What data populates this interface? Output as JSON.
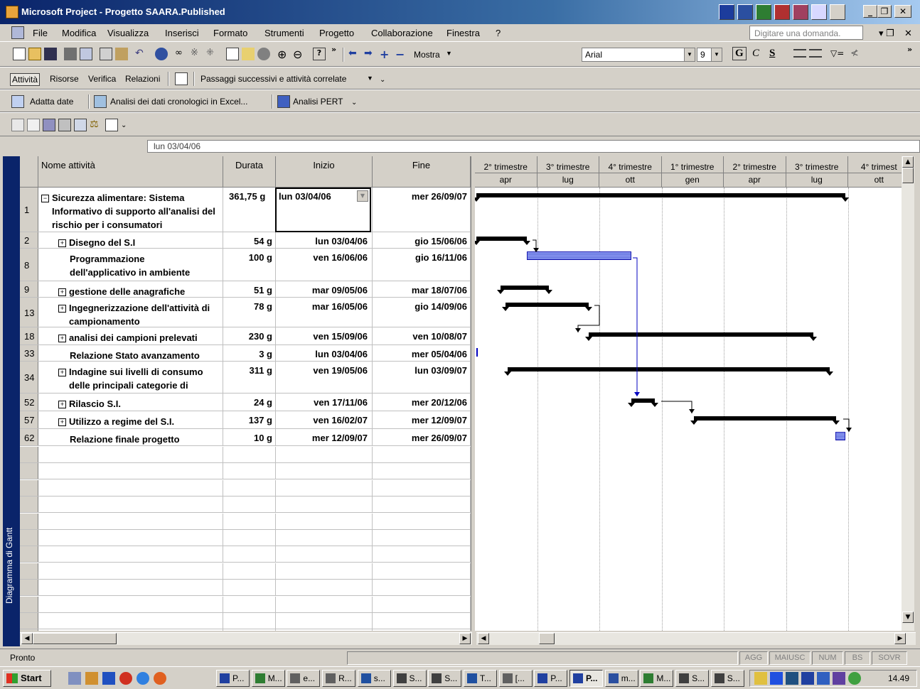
{
  "window": {
    "title": "Microsoft Project - Progetto SAARA.Published"
  },
  "menu": {
    "items": [
      "File",
      "Modifica",
      "Visualizza",
      "Inserisci",
      "Formato",
      "Strumenti",
      "Progetto",
      "Collaborazione",
      "Finestra",
      "?"
    ],
    "ask_placeholder": "Digitare una domanda."
  },
  "toolbar_standard": {
    "show_label": "Mostra",
    "font": "Arial",
    "font_size": "9",
    "bold": "G",
    "italic": "C",
    "underline": "S"
  },
  "toolbar_guide": {
    "items": [
      "Attività",
      "Risorse",
      "Verifica",
      "Relazioni"
    ],
    "guide_label": "Passaggi successivi e attività correlate"
  },
  "toolbar_analysis": {
    "adjust_dates": "Adatta date",
    "excel_analysis": "Analisi dei dati cronologici in Excel...",
    "pert": "Analisi PERT"
  },
  "entry_bar": {
    "value": "lun 03/04/06"
  },
  "view_bar": {
    "label": "Diagramma di Gantt"
  },
  "table": {
    "headers": {
      "name": "Nome attività",
      "duration": "Durata",
      "start": "Inizio",
      "finish": "Fine"
    },
    "rows": [
      {
        "id": "1",
        "expander": "−",
        "name": "Sicurezza alimentare: Sistema Informativo di supporto all'analisi del rischio per i consumatori",
        "duration": "361,75 g",
        "start": "lun 03/04/06",
        "finish": "mer 26/09/07"
      },
      {
        "id": "2",
        "expander": "+",
        "name": "Disegno del S.I",
        "duration": "54 g",
        "start": "lun 03/04/06",
        "finish": "gio 15/06/06"
      },
      {
        "id": "8",
        "expander": "",
        "name": "Programmazione dell'applicativo in ambiente",
        "duration": "100 g",
        "start": "ven 16/06/06",
        "finish": "gio 16/11/06"
      },
      {
        "id": "9",
        "expander": "+",
        "name": "gestione delle anagrafiche",
        "duration": "51 g",
        "start": "mar 09/05/06",
        "finish": "mar 18/07/06"
      },
      {
        "id": "13",
        "expander": "+",
        "name": "Ingegnerizzazione dell'attività di campionamento",
        "duration": "78 g",
        "start": "mar 16/05/06",
        "finish": "gio 14/09/06"
      },
      {
        "id": "18",
        "expander": "+",
        "name": "analisi dei campioni prelevati",
        "duration": "230 g",
        "start": "ven 15/09/06",
        "finish": "ven 10/08/07"
      },
      {
        "id": "33",
        "expander": "",
        "name": "Relazione Stato avanzamento",
        "duration": "3 g",
        "start": "lun 03/04/06",
        "finish": "mer 05/04/06"
      },
      {
        "id": "34",
        "expander": "+",
        "name": "Indagine sui livelli di consumo delle principali categorie di",
        "duration": "311 g",
        "start": "ven 19/05/06",
        "finish": "lun 03/09/07"
      },
      {
        "id": "52",
        "expander": "+",
        "name": "Rilascio S.I.",
        "duration": "24 g",
        "start": "ven 17/11/06",
        "finish": "mer 20/12/06"
      },
      {
        "id": "57",
        "expander": "+",
        "name": "Utilizzo a regime del S.I.",
        "duration": "137 g",
        "start": "ven 16/02/07",
        "finish": "mer 12/09/07"
      },
      {
        "id": "62",
        "expander": "",
        "name": "Relazione finale progetto",
        "duration": "10 g",
        "start": "mer 12/09/07",
        "finish": "mer 26/09/07"
      }
    ]
  },
  "gantt": {
    "quarters": [
      "2° trimestre",
      "3° trimestre",
      "4° trimestre",
      "1° trimestre",
      "2° trimestre",
      "3° trimestre",
      "4° trimest"
    ],
    "months": [
      "apr",
      "lug",
      "ott",
      "gen",
      "apr",
      "lug",
      "ott"
    ]
  },
  "status": {
    "text": "Pronto",
    "indicators": [
      "AGG",
      "MAIUSC",
      "NUM",
      "BS",
      "SOVR"
    ]
  },
  "taskbar": {
    "start": "Start",
    "buttons": [
      "P...",
      "M...",
      "e...",
      "R...",
      "s...",
      "S...",
      "S...",
      "T...",
      "[...",
      "P...",
      "P...",
      "m...",
      "M...",
      "S...",
      "S..."
    ],
    "active_index": 10,
    "clock": "14.49"
  },
  "colors": {
    "titlebar": "#0a246a",
    "task_bar_fill": "#7f8cf0",
    "link_arrow": "#0000c0",
    "summary_bar": "#000000"
  }
}
